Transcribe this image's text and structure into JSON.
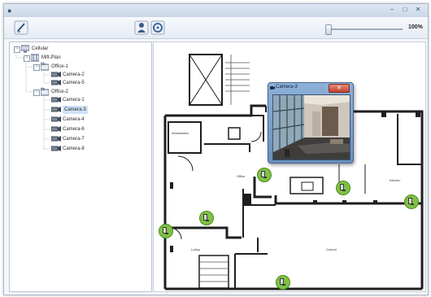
{
  "window": {
    "title": "",
    "zoom_label": "100%"
  },
  "tree": {
    "root": "Cellular",
    "site": "Mift-Plan",
    "groups": [
      {
        "label": "Office-1",
        "cameras": [
          "Camera-2",
          "Camera-5"
        ]
      },
      {
        "label": "Office-2",
        "cameras": [
          "Camera-1",
          "Camera-3",
          "Camera-4",
          "Camera-6",
          "Camera-7",
          "Camera-8"
        ]
      }
    ],
    "selected": "Camera-3"
  },
  "popup": {
    "title": "Camera-3"
  },
  "floorplan": {
    "rooms": [
      "Workstation",
      "Office",
      "Kitchen",
      "Lobby",
      "Control"
    ],
    "camera_count": 7
  },
  "colors": {
    "camera_marker": "#7fc242",
    "accent": "#2f5f9a",
    "selection": "#cfe2f7"
  },
  "icons": [
    "edit-icon",
    "user-icon",
    "settings-icon",
    "camera-icon",
    "minimize-icon",
    "maximize-icon",
    "close-icon"
  ]
}
